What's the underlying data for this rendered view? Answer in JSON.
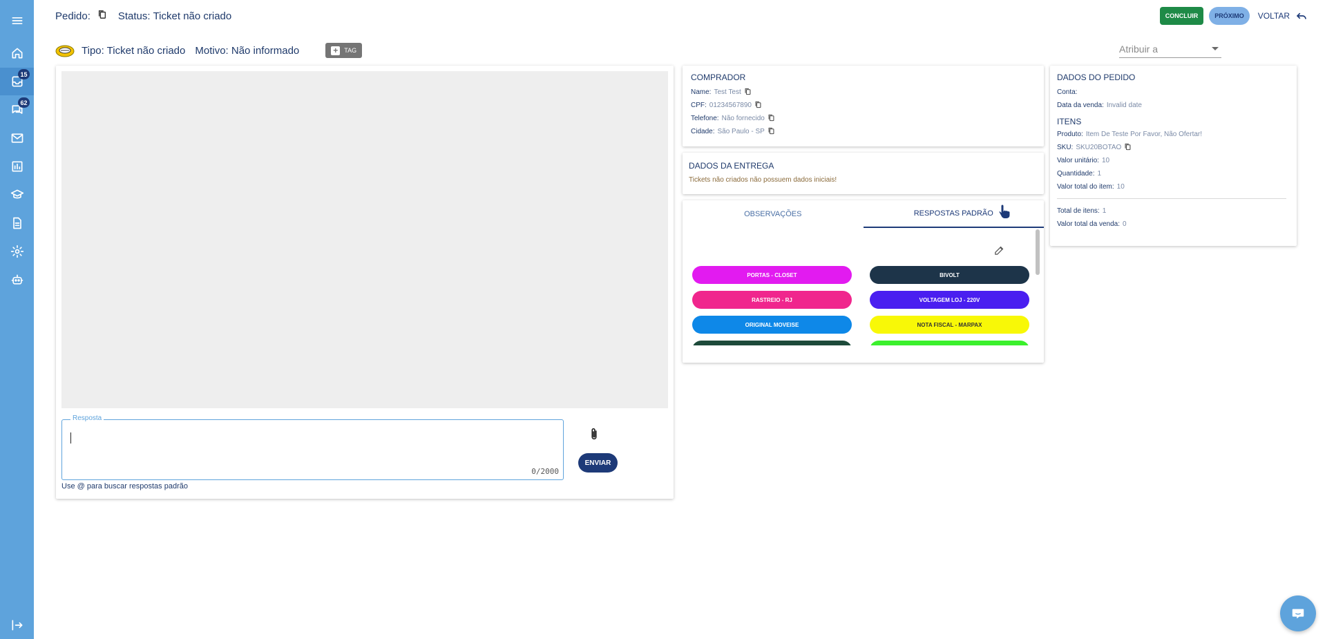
{
  "sidebar": {
    "badges": {
      "tickets": "15",
      "messages": "62"
    },
    "icons": [
      "menu-icon",
      "home-icon",
      "inbox-icon",
      "chat-icon",
      "mail-icon",
      "chart-icon",
      "school-icon",
      "document-icon",
      "settings-icon",
      "robot-icon",
      "logout-icon"
    ]
  },
  "header": {
    "pedido_label": "Pedido:",
    "status_label": "Status:",
    "status_value": "Ticket não criado",
    "tipo": "Tipo: Ticket não criado",
    "motivo": "Motivo: Não informado",
    "tag_label": "TAG",
    "concluir_label": "CONCLUIR",
    "proximo_label": "PRÓXIMO",
    "voltar_label": "VOLTAR",
    "atribuir_placeholder": "Atribuir a"
  },
  "chat": {
    "resposta_label": "Resposta",
    "counter": "0/2000",
    "hint": "Use @ para buscar respostas padrão",
    "enviar_label": "ENVIAR"
  },
  "comprador": {
    "title": "COMPRADOR",
    "rows": [
      {
        "label": "Name:",
        "value": "Test Test"
      },
      {
        "label": "CPF:",
        "value": "01234567890"
      },
      {
        "label": "Telefone:",
        "value": "Não fornecido"
      },
      {
        "label": "Cidade:",
        "value": "São Paulo - SP"
      }
    ]
  },
  "entrega": {
    "title": "DADOS DA ENTREGA",
    "message": "Tickets não criados não possuem dados iniciais!"
  },
  "tabs": {
    "items": [
      "OBSERVAÇÕES",
      "RESPOSTAS PADRÃO"
    ],
    "active_index": 1
  },
  "respostas": [
    {
      "label": "PORTAS - CLOSET",
      "color": "#e21bf0",
      "text_color": "#ffffff"
    },
    {
      "label": "BIVOLT",
      "color": "#1d3449",
      "text_color": "#ffffff"
    },
    {
      "label": "RASTREIO - RJ",
      "color": "#f0268d",
      "text_color": "#ffffff"
    },
    {
      "label": "VOLTAGEM LOJ - 220V",
      "color": "#4a1ff0",
      "text_color": "#ffffff"
    },
    {
      "label": "ORIGINAL MOVEISE",
      "color": "#0e88e8",
      "text_color": "#ffffff"
    },
    {
      "label": "NOTA FISCAL - MARPAX",
      "color": "#f8f807",
      "text_color": "#333333"
    },
    {
      "label": "",
      "color": "#1d4a3a",
      "text_color": "#ffffff"
    },
    {
      "label": "",
      "color": "#3bf02c",
      "text_color": "#ffffff"
    }
  ],
  "pedido": {
    "title": "DADOS DO PEDIDO",
    "conta_label": "Conta:",
    "data_label": "Data da venda:",
    "data_value": "Invalid date",
    "itens_title": "ITENS",
    "produto_label": "Produto:",
    "produto_value": "Item De Teste Por Favor, Não Ofertar!",
    "sku_label": "SKU:",
    "sku_value": "SKU20BOTAO",
    "valor_unit_label": "Valor unitário:",
    "valor_unit_value": "10",
    "quantidade_label": "Quantidade:",
    "quantidade_value": "1",
    "valor_total_item_label": "Valor total do item:",
    "valor_total_item_value": "10",
    "total_itens_label": "Total de itens:",
    "total_itens_value": "1",
    "valor_total_venda_label": "Valor total da venda:",
    "valor_total_venda_value": "0"
  }
}
